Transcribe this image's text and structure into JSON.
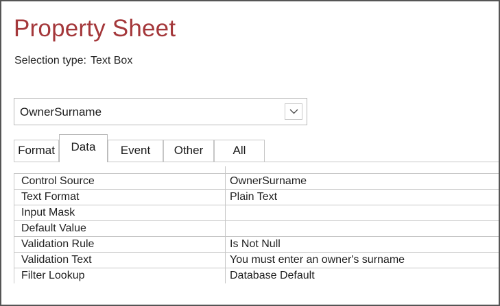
{
  "sheet": {
    "title": "Property Sheet",
    "selection_label": "Selection type:",
    "selection_type": "Text Box"
  },
  "object_selector": {
    "value": "OwnerSurname",
    "dropdown_icon": "chevron-down-icon"
  },
  "tabs": [
    {
      "label": "Format",
      "active": false
    },
    {
      "label": "Data",
      "active": true
    },
    {
      "label": "Event",
      "active": false
    },
    {
      "label": "Other",
      "active": false
    },
    {
      "label": "All",
      "active": false
    }
  ],
  "properties": [
    {
      "name": "Control Source",
      "value": "OwnerSurname"
    },
    {
      "name": "Text Format",
      "value": "Plain Text"
    },
    {
      "name": "Input Mask",
      "value": ""
    },
    {
      "name": "Default Value",
      "value": ""
    },
    {
      "name": "Validation Rule",
      "value": "Is Not Null"
    },
    {
      "name": "Validation Text",
      "value": "You must enter an owner's surname"
    },
    {
      "name": "Filter Lookup",
      "value": "Database Default"
    }
  ],
  "colors": {
    "title": "#a4373a",
    "border": "#c6c6c6",
    "frame": "#555555"
  }
}
